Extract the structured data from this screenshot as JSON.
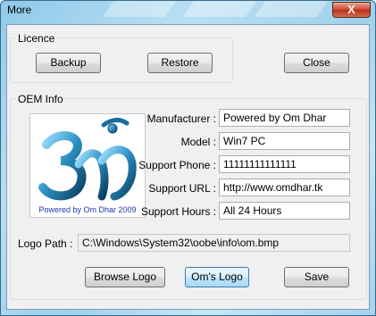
{
  "window": {
    "title": "More",
    "close_glyph": "X"
  },
  "licence": {
    "label": "Licence",
    "backup_label": "Backup",
    "restore_label": "Restore",
    "close_label": "Close"
  },
  "oem": {
    "label": "OEM Info",
    "logo_caption": "Powered by Om Dhar 2009",
    "manufacturer_label": "Manufacturer :",
    "manufacturer_value": "Powered by Om Dhar",
    "model_label": "Model :",
    "model_value": "Win7 PC",
    "phone_label": "Support Phone :",
    "phone_value": "11111111111111",
    "url_label": "Support URL :",
    "url_value": "http://www.omdhar.tk",
    "hours_label": "Support Hours :",
    "hours_value": "All 24 Hours",
    "logo_path_label": "Logo Path :",
    "logo_path_value": "C:\\Windows\\System32\\oobe\\info\\om.bmp",
    "browse_label": "Browse Logo",
    "oms_logo_label": "Om's Logo",
    "save_label": "Save"
  },
  "colors": {
    "title_bar": "#a3d3ee",
    "close_button": "#d0452b",
    "om_symbol": "#2a8fc0",
    "logo_caption": "#1e3aa8"
  },
  "icons": {
    "logo": "om-symbol-icon"
  }
}
